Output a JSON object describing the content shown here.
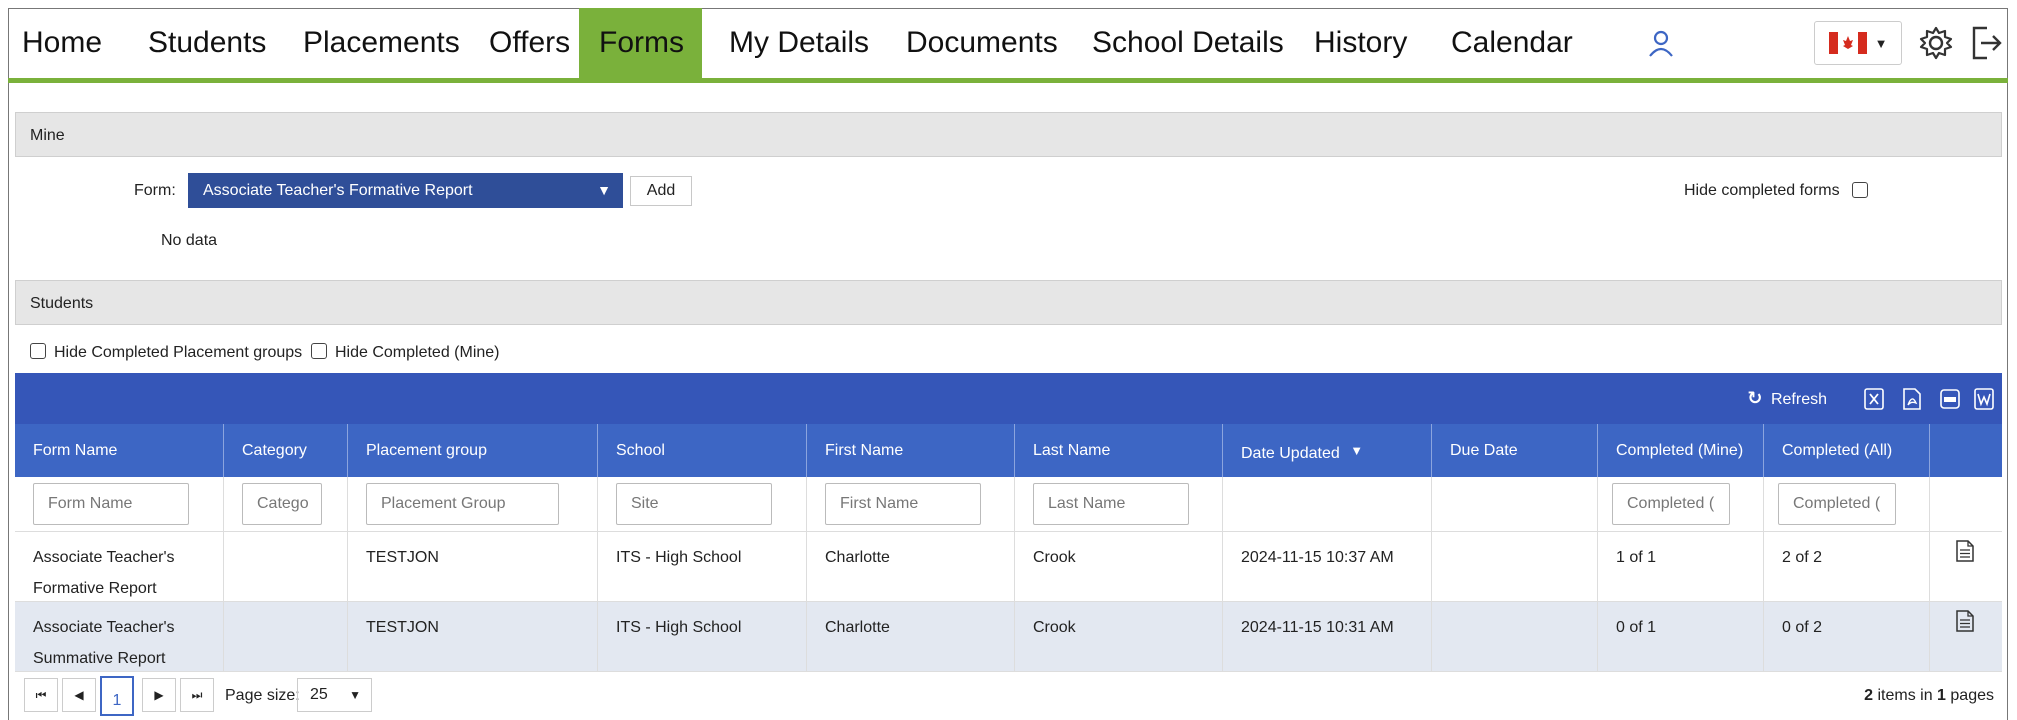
{
  "nav": {
    "items": [
      "Home",
      "Students",
      "Placements",
      "Offers",
      "Forms",
      "My Details",
      "Documents",
      "School Details",
      "History",
      "Calendar"
    ],
    "active": "Forms",
    "accent_color": "#7ab13b",
    "icons": [
      "user-icon",
      "canada-flag-icon",
      "gear-icon",
      "logout-icon"
    ]
  },
  "mine": {
    "section_title": "Mine",
    "form_label": "Form:",
    "form_selected": "Associate Teacher's Formative Report",
    "add_label": "Add",
    "hide_completed_label": "Hide completed forms",
    "no_data": "No data"
  },
  "students": {
    "section_title": "Students",
    "hide_groups_label": "Hide Completed Placement groups",
    "hide_mine_label": "Hide Completed (Mine)"
  },
  "grid": {
    "refresh_label": "Refresh",
    "toolbar_color": "#3556b8",
    "columns": [
      "Form Name",
      "Category",
      "Placement group",
      "School",
      "First Name",
      "Last Name",
      "Date Updated",
      "Due Date",
      "Completed (Mine)",
      "Completed (All)"
    ],
    "filters": [
      "Form Name",
      "Catego",
      "Placement Group",
      "Site",
      "First Name",
      "Last Name",
      "",
      "",
      "Completed (",
      "Completed ("
    ],
    "rows": [
      {
        "form_name_1": "Associate Teacher's",
        "form_name_2": "Formative Report",
        "category": "",
        "group": "TESTJON",
        "school": "ITS - High School",
        "first": "Charlotte",
        "last": "Crook",
        "date": "2024-11-15 10:37 AM",
        "due": "",
        "mine": "1 of 1",
        "all": "2 of 2"
      },
      {
        "form_name_1": "Associate Teacher's",
        "form_name_2": "Summative Report",
        "category": "",
        "group": "TESTJON",
        "school": "ITS - High School",
        "first": "Charlotte",
        "last": "Crook",
        "date": "2024-11-15 10:31 AM",
        "due": "",
        "mine": "0 of 1",
        "all": "0 of 2"
      }
    ]
  },
  "pager": {
    "current_page": "1",
    "page_size_label": "Page size:",
    "page_size": "25",
    "items_count": "2",
    "items_text": "items in",
    "pages_count": "1",
    "pages_text": "pages"
  }
}
